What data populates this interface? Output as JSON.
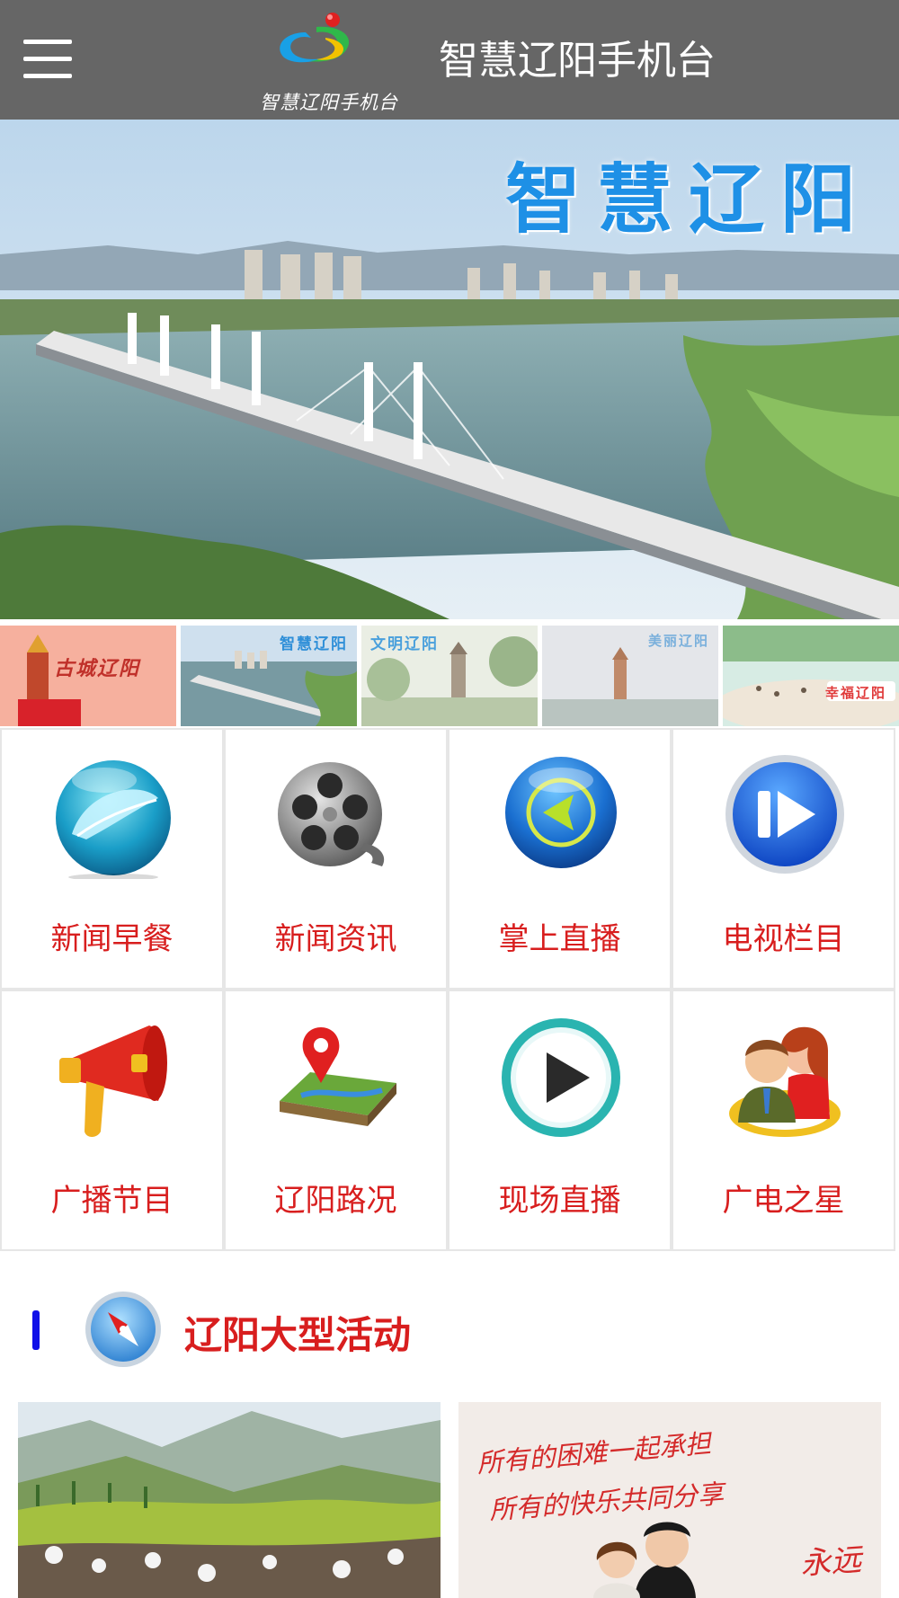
{
  "header": {
    "logo_caption": "智慧辽阳手机台",
    "title": "智慧辽阳手机台"
  },
  "banner": {
    "title": "智慧辽阳"
  },
  "thumbnails": [
    {
      "label": "古城辽阳"
    },
    {
      "label": "智慧辽阳"
    },
    {
      "label": "文明辽阳"
    },
    {
      "label": "美丽辽阳"
    },
    {
      "label": "幸福辽阳"
    }
  ],
  "grid": [
    {
      "label": "新闻早餐",
      "icon": "leaf-globe-icon"
    },
    {
      "label": "新闻资讯",
      "icon": "film-reel-icon"
    },
    {
      "label": "掌上直播",
      "icon": "back-arrow-icon"
    },
    {
      "label": "电视栏目",
      "icon": "skip-play-icon"
    },
    {
      "label": "广播节目",
      "icon": "megaphone-icon"
    },
    {
      "label": "辽阳路况",
      "icon": "map-pin-icon"
    },
    {
      "label": "现场直播",
      "icon": "play-icon"
    },
    {
      "label": "广电之星",
      "icon": "people-icon"
    }
  ],
  "section": {
    "title": "辽阳大型活动",
    "icon": "compass-icon"
  },
  "cards": [
    {
      "text": []
    },
    {
      "text": [
        "所有的困难一起承担",
        "所有的快乐共同分享",
        "永远"
      ]
    }
  ],
  "colors": {
    "header_bg": "#666666",
    "accent_red": "#d81e1e",
    "section_bar": "#1010e8"
  }
}
